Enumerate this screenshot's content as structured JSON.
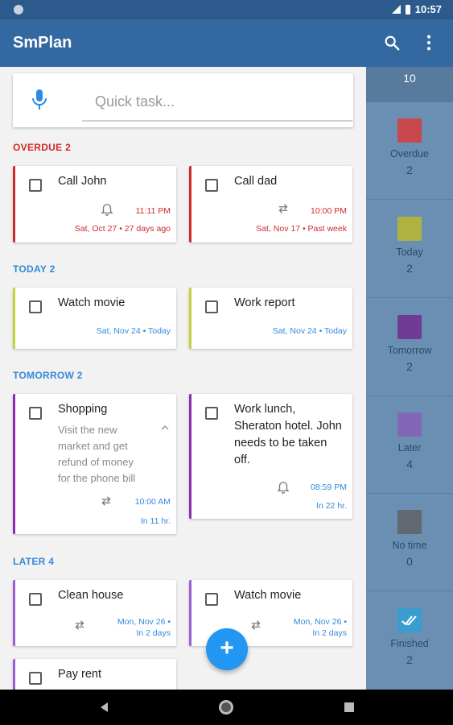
{
  "status_bar": {
    "time": "10:57"
  },
  "app_bar": {
    "title": "SmPlan"
  },
  "quick_task": {
    "placeholder": "Quick task..."
  },
  "sections": {
    "overdue": {
      "label": "OVERDUE 2",
      "color": "#d02a2a"
    },
    "today": {
      "label": "TODAY 2",
      "color": "#3489d9"
    },
    "tomorrow": {
      "label": "TOMORROW 2",
      "color": "#3489d9"
    },
    "later": {
      "label": "LATER 4",
      "color": "#3489d9"
    }
  },
  "tasks": {
    "call_john": {
      "title": "Call John",
      "time": "11:11 PM",
      "date": "Sat, Oct 27 • 27 days ago",
      "icon": "bell-icon",
      "accent": "#d02a2a"
    },
    "call_dad": {
      "title": "Call dad",
      "time": "10:00 PM",
      "date": "Sat, Nov 17 • Past week",
      "icon": "repeat-icon",
      "accent": "#d02a2a"
    },
    "watch_movie_today": {
      "title": "Watch movie",
      "date": "Sat, Nov 24 • Today",
      "accent": "#c6d23a"
    },
    "work_report": {
      "title": "Work report",
      "date": "Sat, Nov 24 • Today",
      "accent": "#c6d23a"
    },
    "shopping": {
      "title": "Shopping",
      "note": "Visit the new market and get refund of money for the phone bill",
      "time": "10:00 AM",
      "date": "In 11 hr.",
      "icon": "repeat-icon",
      "accent": "#8b2fb0"
    },
    "work_lunch": {
      "title": "Work lunch, Sheraton hotel. John needs to be taken off.",
      "time": "08:59 PM",
      "date": "In 22 hr.",
      "icon": "bell-icon",
      "accent": "#8b2fb0"
    },
    "clean_house": {
      "title": "Clean house",
      "date_line1": "Mon, Nov 26 •",
      "date_line2": "In 2 days",
      "icon": "repeat-icon",
      "accent": "#9b5fd0"
    },
    "watch_movie_later": {
      "title": "Watch movie",
      "date_line1": "Mon, Nov 26 •",
      "date_line2": "In 2 days",
      "icon": "repeat-icon",
      "accent": "#9b5fd0"
    },
    "pay_rent": {
      "title": "Pay rent",
      "accent": "#9b5fd0"
    }
  },
  "sidebar": {
    "header_count": "10",
    "items": [
      {
        "label": "Overdue",
        "count": "2",
        "color": "#c9484d"
      },
      {
        "label": "Today",
        "count": "2",
        "color": "#aeb23f"
      },
      {
        "label": "Tomorrow",
        "count": "2",
        "color": "#6f3b94"
      },
      {
        "label": "Later",
        "count": "4",
        "color": "#8466b6"
      },
      {
        "label": "No time",
        "count": "0",
        "color": "#62686f"
      },
      {
        "label": "Finished",
        "count": "2",
        "color": "#3a9dd0",
        "icon": "double-check-icon"
      }
    ]
  }
}
